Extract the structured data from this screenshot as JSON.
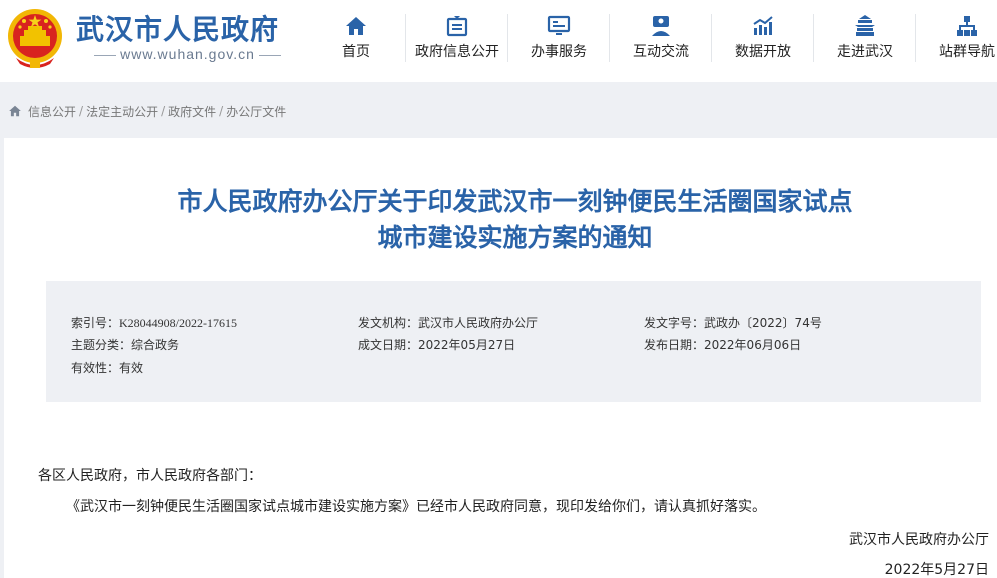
{
  "header": {
    "site_title": "武汉市人民政府",
    "site_url": "www.wuhan.gov.cn",
    "brand_color": "#2a63a8",
    "nav": [
      {
        "label": "首页",
        "icon": "home-icon"
      },
      {
        "label": "政府信息公开",
        "icon": "info-disclosure-icon"
      },
      {
        "label": "办事服务",
        "icon": "service-icon"
      },
      {
        "label": "互动交流",
        "icon": "interaction-icon"
      },
      {
        "label": "数据开放",
        "icon": "data-chart-icon"
      },
      {
        "label": "走进武汉",
        "icon": "city-gate-icon"
      },
      {
        "label": "站群导航",
        "icon": "sitemap-icon"
      }
    ]
  },
  "breadcrumb": [
    "信息公开",
    "法定主动公开",
    "政府文件",
    "办公厅文件"
  ],
  "document": {
    "title_line1": "市人民政府办公厅关于印发武汉市一刻钟便民生活圈国家试点",
    "title_line2": "城市建设实施方案的通知",
    "meta": {
      "index_label": "索引号：",
      "index_value": "K28044908/2022-17615",
      "issuer_label": "发文机构：",
      "issuer_value": "武汉市人民政府办公厅",
      "doc_no_label": "发文字号：",
      "doc_no_value": "武政办〔2022〕74号",
      "category_label": "主题分类：",
      "category_value": "综合政务",
      "made_date_label": "成文日期：",
      "made_date_value": "2022年05月27日",
      "publish_date_label": "发布日期：",
      "publish_date_value": "2022年06月06日",
      "validity_label": "有效性：",
      "validity_value": "有效"
    },
    "salutation": "各区人民政府，市人民政府各部门：",
    "body": "《武汉市一刻钟便民生活圈国家试点城市建设实施方案》已经市人民政府同意，现印发给你们，请认真抓好落实。",
    "signer": "武汉市人民政府办公厅",
    "date": "2022年5月27日"
  }
}
